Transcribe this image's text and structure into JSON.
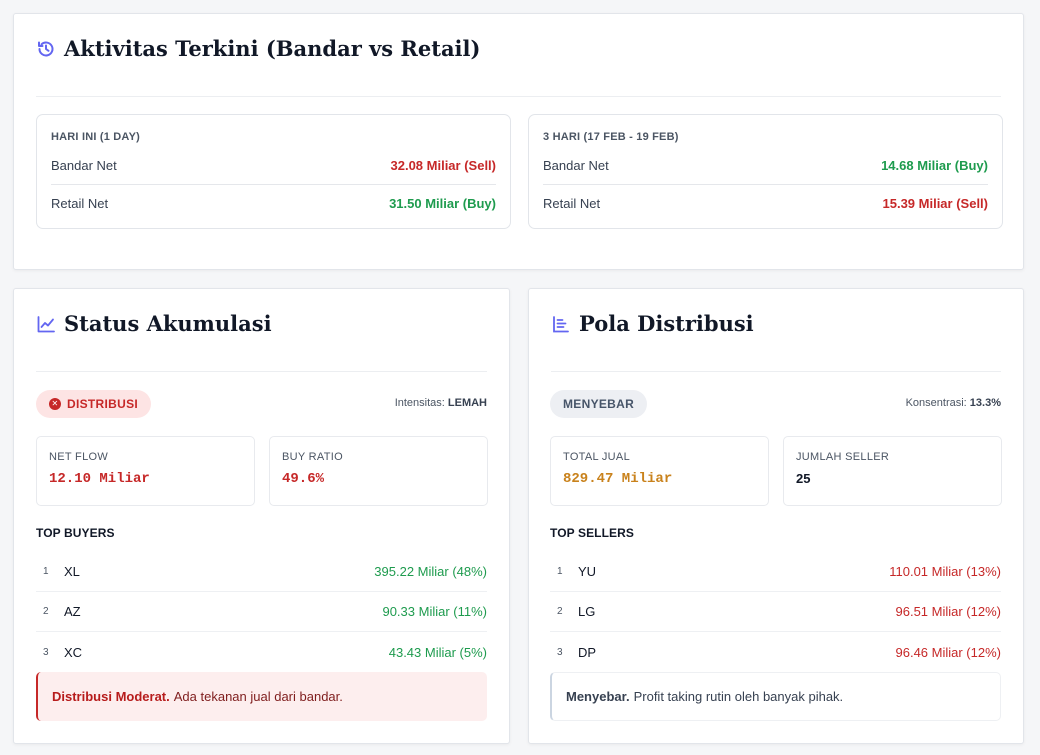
{
  "activity": {
    "title": "Aktivitas Terkini (Bandar vs Retail)",
    "periods": [
      {
        "label": "HARI INI (1 DAY)",
        "rows": [
          {
            "label": "Bandar Net",
            "value": "32.08 Miliar (Sell)",
            "tone": "sell"
          },
          {
            "label": "Retail Net",
            "value": "31.50 Miliar (Buy)",
            "tone": "buy"
          }
        ]
      },
      {
        "label": "3 HARI (17 FEB - 19 FEB)",
        "rows": [
          {
            "label": "Bandar Net",
            "value": "14.68 Miliar (Buy)",
            "tone": "buy"
          },
          {
            "label": "Retail Net",
            "value": "15.39 Miliar (Sell)",
            "tone": "sell"
          }
        ]
      }
    ]
  },
  "accumulation": {
    "title": "Status Akumulasi",
    "badge": "DISTRIBUSI",
    "badge_icon": "x-circle-icon",
    "intensity_label": "Intensitas:",
    "intensity_value": "LEMAH",
    "stats": [
      {
        "label": "NET FLOW",
        "value": "12.10 Miliar"
      },
      {
        "label": "BUY RATIO",
        "value": "49.6%"
      }
    ],
    "list_title": "TOP BUYERS",
    "buyers": [
      {
        "rank": "1",
        "code": "XL",
        "value": "395.22 Miliar (48%)"
      },
      {
        "rank": "2",
        "code": "AZ",
        "value": "90.33 Miliar (11%)"
      },
      {
        "rank": "3",
        "code": "XC",
        "value": "43.43 Miliar (5%)"
      }
    ],
    "note_bold": "Distribusi Moderat.",
    "note_text": "Ada tekanan jual dari bandar."
  },
  "distribution": {
    "title": "Pola Distribusi",
    "badge": "MENYEBAR",
    "concentration_label": "Konsentrasi:",
    "concentration_value": "13.3%",
    "stats": [
      {
        "label": "TOTAL JUAL",
        "value": "829.47 Miliar"
      },
      {
        "label": "JUMLAH SELLER",
        "value": "25"
      }
    ],
    "list_title": "TOP SELLERS",
    "sellers": [
      {
        "rank": "1",
        "code": "YU",
        "value": "110.01 Miliar (13%)"
      },
      {
        "rank": "2",
        "code": "LG",
        "value": "96.51 Miliar (12%)"
      },
      {
        "rank": "3",
        "code": "DP",
        "value": "96.46 Miliar (12%)"
      }
    ],
    "note_bold": "Menyebar.",
    "note_text": "Profit taking rutin oleh banyak pihak."
  },
  "colors": {
    "sell": "#c62828",
    "buy": "#1e9b4e",
    "accent_icon": "#6366f1",
    "total_jual": "#c9821c"
  },
  "icons": {
    "activity": "history-icon",
    "accumulation": "trend-chart-icon",
    "distribution": "bar-list-icon"
  }
}
